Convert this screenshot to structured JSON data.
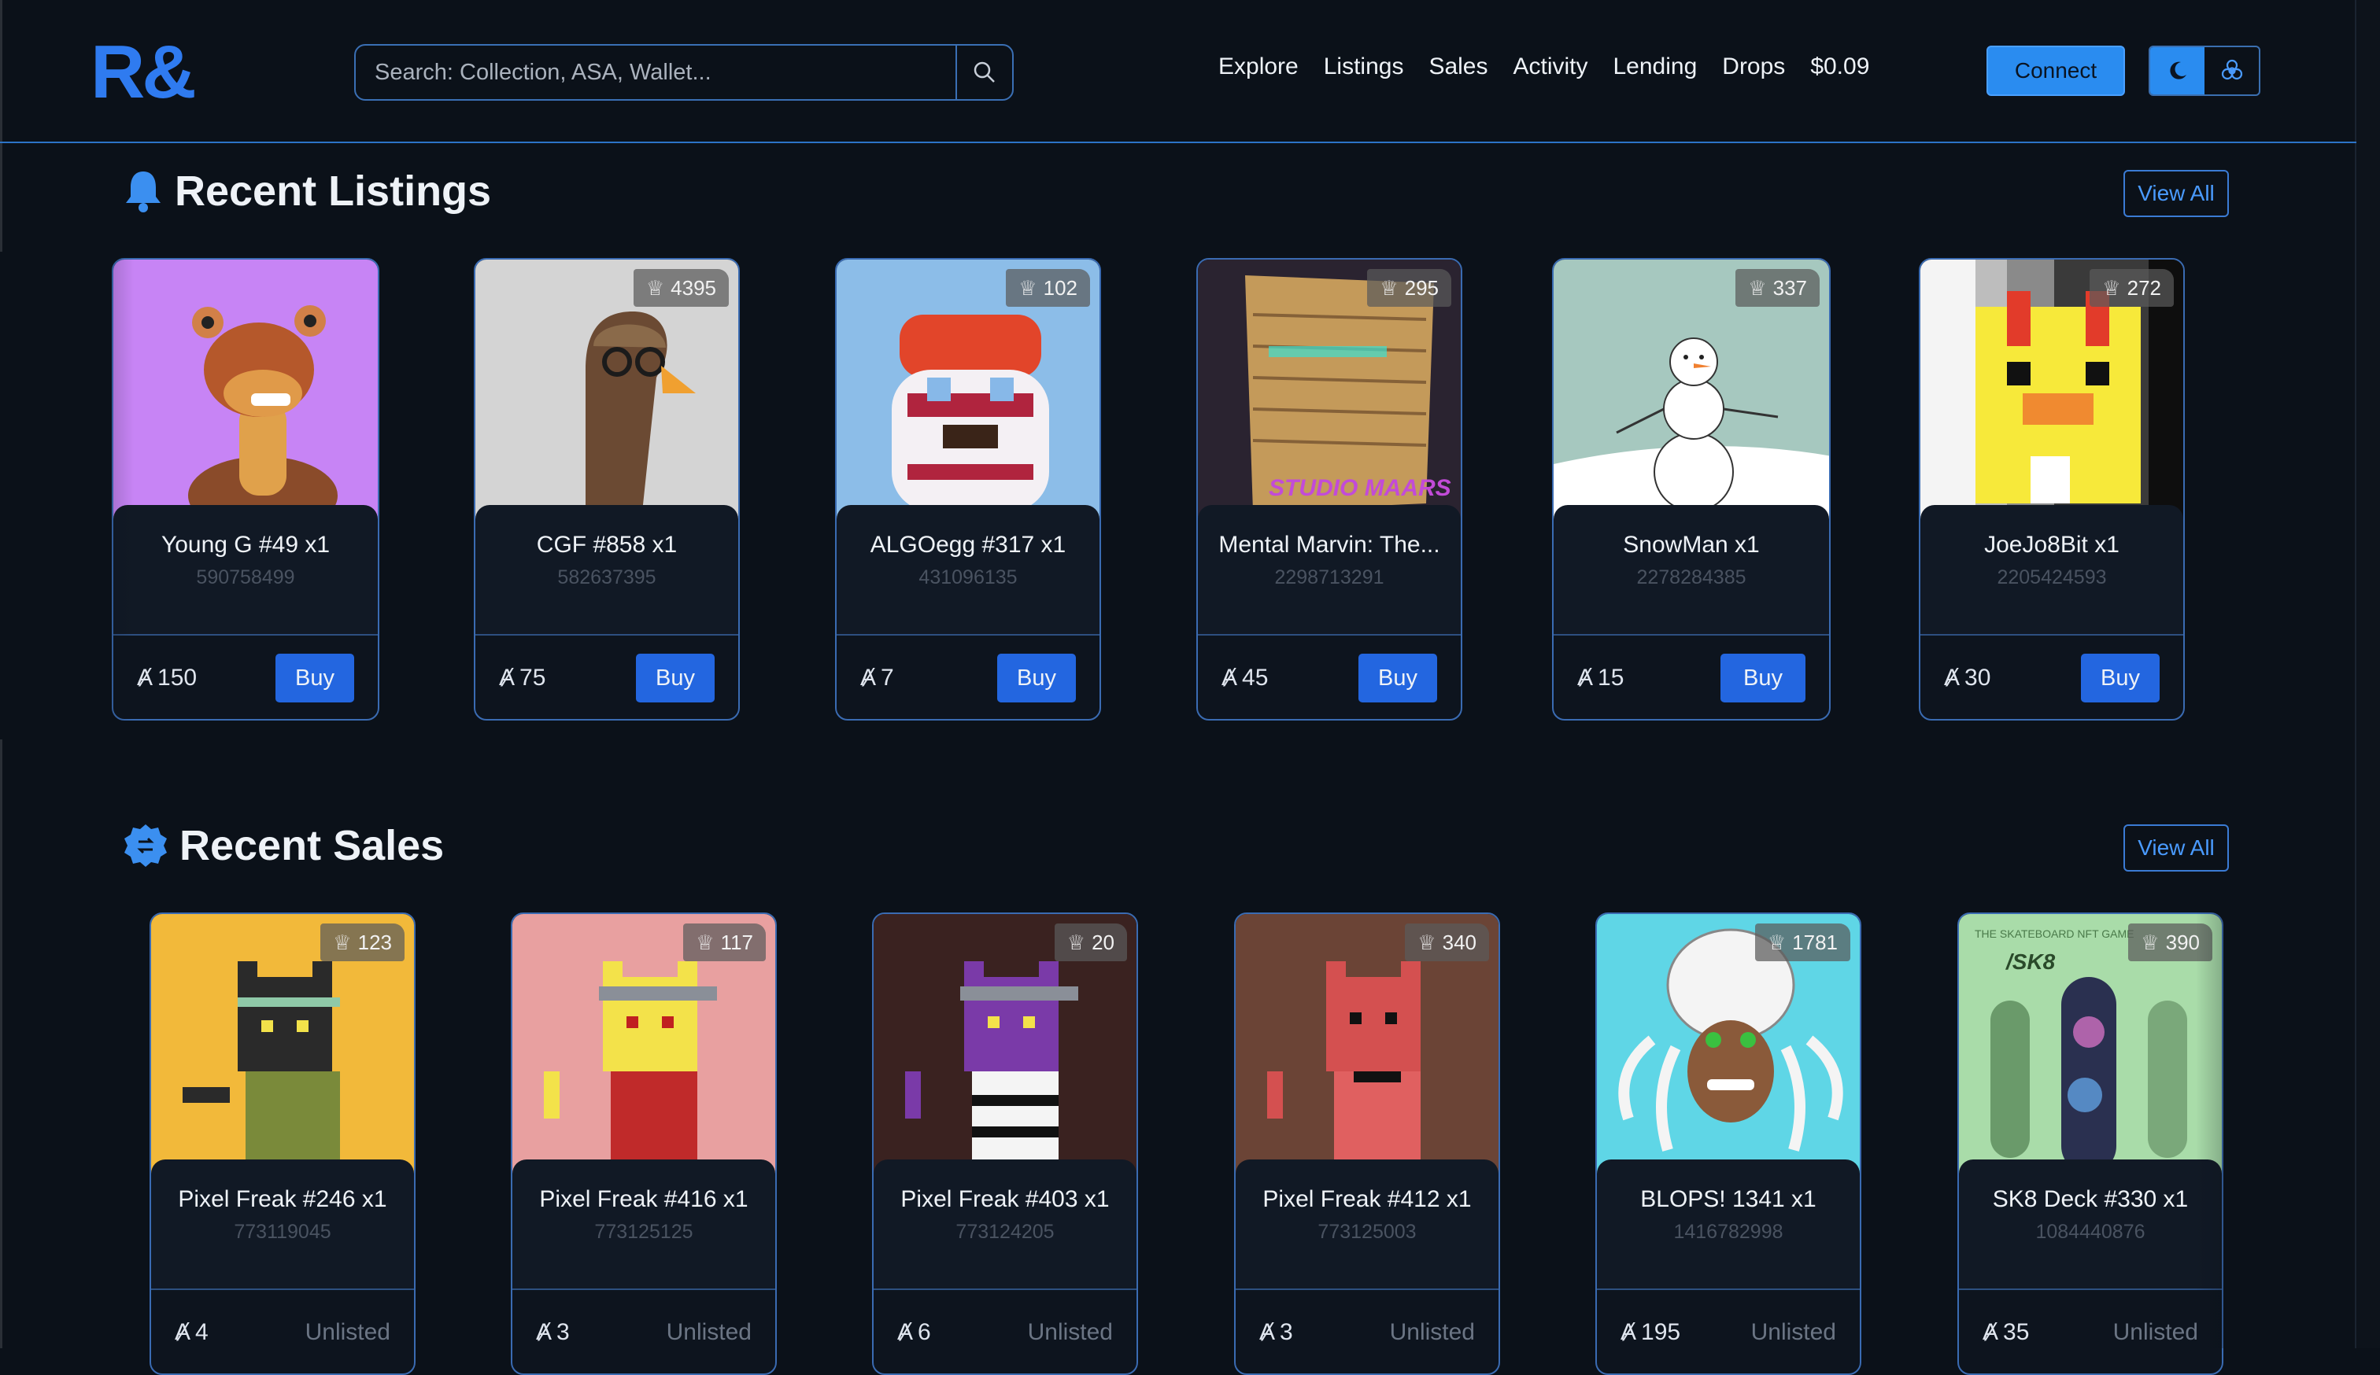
{
  "header": {
    "logo": "R&",
    "search_placeholder": "Search: Collection, ASA, Wallet...",
    "nav": [
      "Explore",
      "Listings",
      "Sales",
      "Activity",
      "Lending",
      "Drops",
      "$0.09"
    ],
    "connect_label": "Connect"
  },
  "listings": {
    "title": "Recent Listings",
    "view_all": "View All",
    "items": [
      {
        "name": "Young G #49 x1",
        "asa": "590758499",
        "price": "150",
        "action": "Buy"
      },
      {
        "name": "CGF #858 x1",
        "asa": "582637395",
        "price": "75",
        "action": "Buy",
        "badge": "4395"
      },
      {
        "name": "ALGOegg #317 x1",
        "asa": "431096135",
        "price": "7",
        "action": "Buy",
        "badge": "102"
      },
      {
        "name": "Mental Marvin: The...",
        "asa": "2298713291",
        "price": "45",
        "action": "Buy",
        "badge": "295"
      },
      {
        "name": "SnowMan x1",
        "asa": "2278284385",
        "price": "15",
        "action": "Buy",
        "badge": "337"
      },
      {
        "name": "JoeJo8Bit x1",
        "asa": "2205424593",
        "price": "30",
        "action": "Buy",
        "badge": "272"
      }
    ]
  },
  "sales": {
    "title": "Recent Sales",
    "view_all": "View All",
    "items": [
      {
        "name": "Pixel Freak #246 x1",
        "asa": "773119045",
        "price": "4",
        "status": "Unlisted",
        "badge": "123"
      },
      {
        "name": "Pixel Freak #416 x1",
        "asa": "773125125",
        "price": "3",
        "status": "Unlisted",
        "badge": "117"
      },
      {
        "name": "Pixel Freak #403 x1",
        "asa": "773124205",
        "price": "6",
        "status": "Unlisted",
        "badge": "20"
      },
      {
        "name": "Pixel Freak #412 x1",
        "asa": "773125003",
        "price": "3",
        "status": "Unlisted",
        "badge": "340"
      },
      {
        "name": "BLOPS! 1341 x1",
        "asa": "1416782998",
        "price": "195",
        "status": "Unlisted",
        "badge": "1781"
      },
      {
        "name": "SK8 Deck #330 x1",
        "asa": "1084440876",
        "price": "35",
        "status": "Unlisted",
        "badge": "390"
      }
    ]
  },
  "art_text": {
    "mental_marvin": "STUDIO MAARS",
    "sk8": "/SK8",
    "sk8_top": "THE SKATEBOARD NFT GAME"
  },
  "colors": {
    "accent": "#2a8cf0",
    "background": "#0b1119",
    "buy": "#2366e0",
    "border": "#3a6bb2"
  },
  "icons": {
    "listings": "bell-icon",
    "sales": "badge-exchange-icon",
    "price": "algo-icon",
    "rank": "crown-icon"
  }
}
